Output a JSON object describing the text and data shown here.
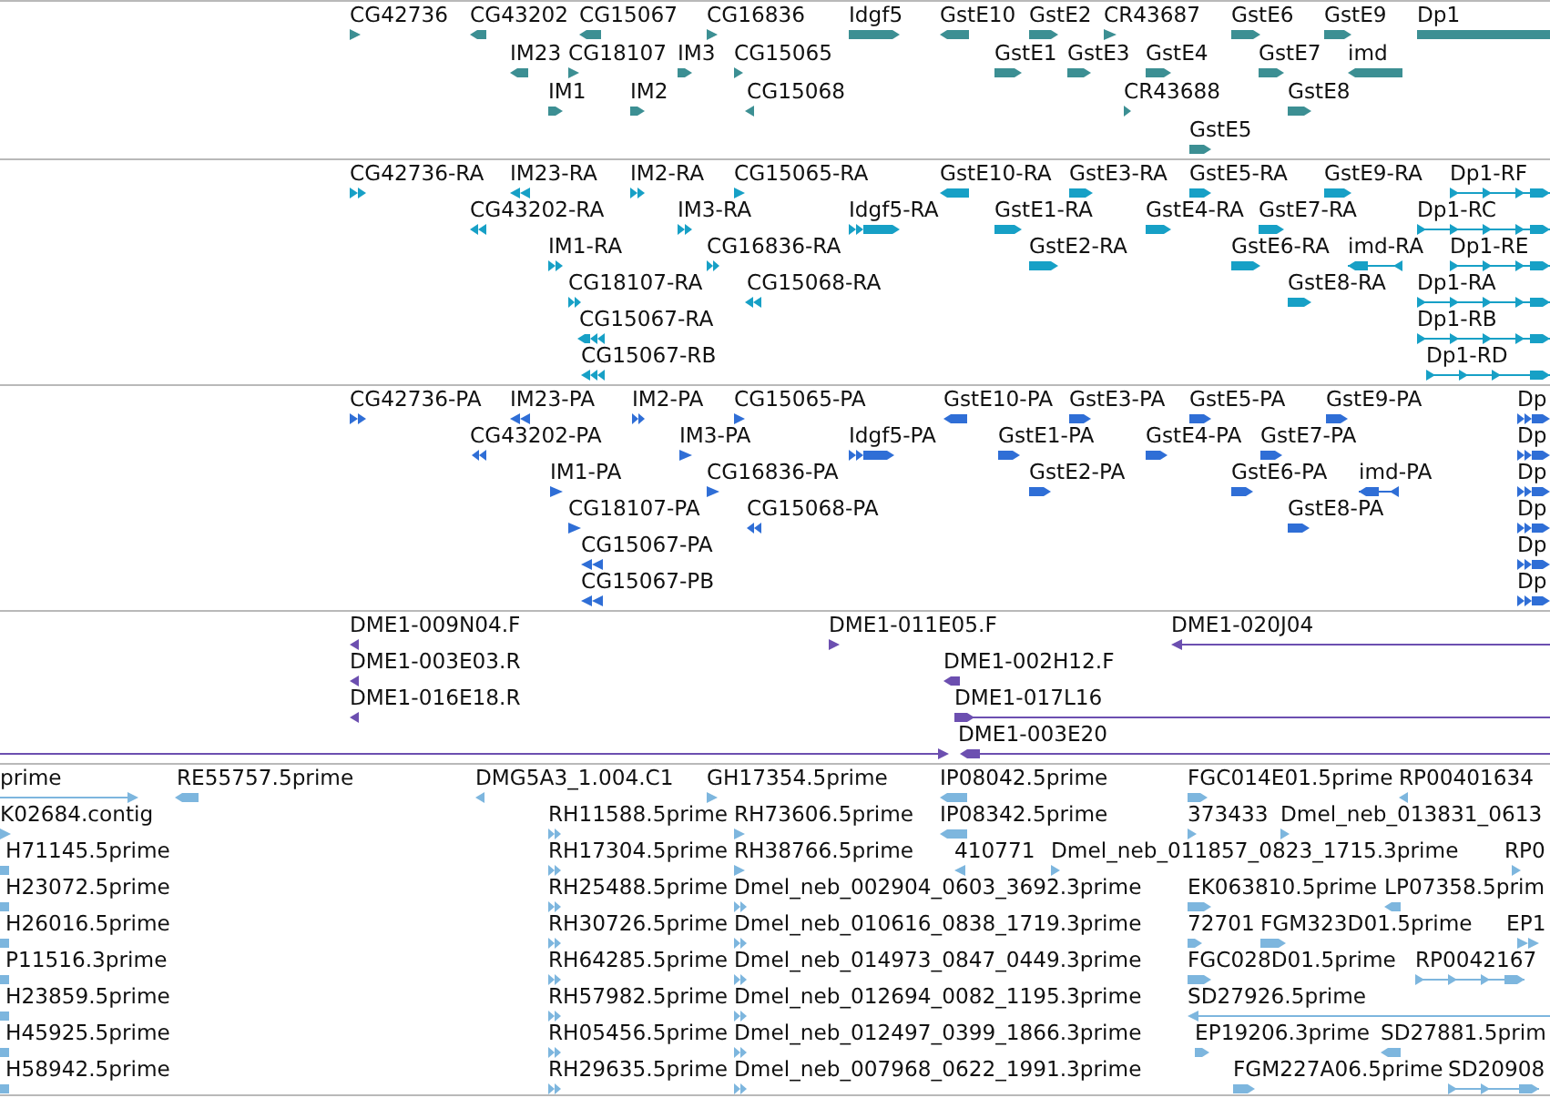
{
  "tracks": [
    {
      "color": "#3c8f93",
      "rows": [
        {
          "features": [
            {
              "label": "CG42736",
              "reverse": false
            },
            {
              "label": "CG43202",
              "reverse": true
            },
            {
              "label": "CG15067",
              "reverse": true
            },
            {
              "label": "CG16836",
              "reverse": false
            },
            {
              "label": "Idgf5",
              "reverse": false
            },
            {
              "label": "GstE10",
              "reverse": true
            },
            {
              "label": "GstE2",
              "reverse": false
            },
            {
              "label": "CR43687",
              "reverse": false
            },
            {
              "label": "GstE6",
              "reverse": false
            },
            {
              "label": "GstE9",
              "reverse": false
            },
            {
              "label": "Dp1"
            }
          ]
        },
        {
          "features": [
            {
              "label": "IM23",
              "reverse": true
            },
            {
              "label": "CG18107",
              "reverse": false
            },
            {
              "label": "IM3",
              "reverse": false
            },
            {
              "label": "CG15065",
              "reverse": false
            },
            {
              "label": "GstE1",
              "reverse": false
            },
            {
              "label": "GstE3",
              "reverse": false
            },
            {
              "label": "GstE4",
              "reverse": false
            },
            {
              "label": "GstE7",
              "reverse": false
            },
            {
              "label": "imd",
              "reverse": true
            }
          ]
        },
        {
          "features": [
            {
              "label": "IM1",
              "reverse": false
            },
            {
              "label": "IM2",
              "reverse": false
            },
            {
              "label": "CG15068",
              "reverse": true
            },
            {
              "label": "CR43688",
              "reverse": false
            },
            {
              "label": "GstE8",
              "reverse": false
            }
          ]
        },
        {
          "features": [
            {
              "label": "GstE5",
              "reverse": false
            }
          ]
        }
      ]
    },
    {
      "color": "#17a0c6",
      "rows": [
        {
          "features": [
            {
              "label": "CG42736-RA",
              "reverse": false
            },
            {
              "label": "IM23-RA",
              "reverse": true
            },
            {
              "label": "IM2-RA",
              "reverse": false
            },
            {
              "label": "CG15065-RA",
              "reverse": false
            },
            {
              "label": "GstE10-RA",
              "reverse": true
            },
            {
              "label": "GstE3-RA",
              "reverse": false
            },
            {
              "label": "GstE5-RA",
              "reverse": false
            },
            {
              "label": "GstE9-RA",
              "reverse": false
            },
            {
              "label": "Dp1-RF",
              "reverse": false
            }
          ]
        },
        {
          "features": [
            {
              "label": "CG43202-RA",
              "reverse": true
            },
            {
              "label": "IM3-RA",
              "reverse": false
            },
            {
              "label": "Idgf5-RA",
              "reverse": false
            },
            {
              "label": "GstE1-RA",
              "reverse": false
            },
            {
              "label": "GstE4-RA",
              "reverse": false
            },
            {
              "label": "GstE7-RA",
              "reverse": false
            },
            {
              "label": "Dp1-RC",
              "reverse": false
            }
          ]
        },
        {
          "features": [
            {
              "label": "IM1-RA",
              "reverse": false
            },
            {
              "label": "CG16836-RA",
              "reverse": false
            },
            {
              "label": "GstE2-RA",
              "reverse": false
            },
            {
              "label": "GstE6-RA",
              "reverse": false
            },
            {
              "label": "imd-RA",
              "reverse": true
            },
            {
              "label": "Dp1-RE",
              "reverse": false
            }
          ]
        },
        {
          "features": [
            {
              "label": "CG18107-RA",
              "reverse": false
            },
            {
              "label": "CG15068-RA",
              "reverse": true
            },
            {
              "label": "GstE8-RA",
              "reverse": false
            },
            {
              "label": "Dp1-RA",
              "reverse": false
            }
          ]
        },
        {
          "features": [
            {
              "label": "CG15067-RA",
              "reverse": true
            },
            {
              "label": "Dp1-RB",
              "reverse": false
            }
          ]
        },
        {
          "features": [
            {
              "label": "CG15067-RB",
              "reverse": true
            },
            {
              "label": "Dp1-RD",
              "reverse": false
            }
          ]
        }
      ]
    },
    {
      "color": "#2f6ed6",
      "rows": [
        {
          "features": [
            {
              "label": "CG42736-PA",
              "reverse": false
            },
            {
              "label": "IM23-PA",
              "reverse": true
            },
            {
              "label": "IM2-PA",
              "reverse": false
            },
            {
              "label": "CG15065-PA",
              "reverse": false
            },
            {
              "label": "GstE10-PA",
              "reverse": true
            },
            {
              "label": "GstE3-PA",
              "reverse": false
            },
            {
              "label": "GstE5-PA",
              "reverse": false
            },
            {
              "label": "GstE9-PA",
              "reverse": false
            },
            {
              "label": "Dp",
              "reverse": false
            }
          ]
        },
        {
          "features": [
            {
              "label": "CG43202-PA",
              "reverse": true
            },
            {
              "label": "IM3-PA",
              "reverse": false
            },
            {
              "label": "Idgf5-PA",
              "reverse": false
            },
            {
              "label": "GstE1-PA",
              "reverse": false
            },
            {
              "label": "GstE4-PA",
              "reverse": false
            },
            {
              "label": "GstE7-PA",
              "reverse": false
            },
            {
              "label": "Dp",
              "reverse": false
            }
          ]
        },
        {
          "features": [
            {
              "label": "IM1-PA",
              "reverse": false
            },
            {
              "label": "CG16836-PA",
              "reverse": false
            },
            {
              "label": "GstE2-PA",
              "reverse": false
            },
            {
              "label": "GstE6-PA",
              "reverse": false
            },
            {
              "label": "imd-PA",
              "reverse": true
            },
            {
              "label": "Dp",
              "reverse": false
            }
          ]
        },
        {
          "features": [
            {
              "label": "CG18107-PA",
              "reverse": false
            },
            {
              "label": "CG15068-PA",
              "reverse": true
            },
            {
              "label": "GstE8-PA",
              "reverse": false
            },
            {
              "label": "Dp",
              "reverse": false
            }
          ]
        },
        {
          "features": [
            {
              "label": "CG15067-PA",
              "reverse": true
            },
            {
              "label": "Dp",
              "reverse": false
            }
          ]
        },
        {
          "features": [
            {
              "label": "CG15067-PB",
              "reverse": true
            },
            {
              "label": "Dp",
              "reverse": false
            }
          ]
        }
      ]
    },
    {
      "color": "#6c4fb0",
      "rows": [
        {
          "features": [
            {
              "label": "DME1-009N04.F",
              "reverse": true
            },
            {
              "label": "DME1-011E05.F",
              "reverse": false
            },
            {
              "label": "DME1-020J04",
              "reverse": true
            }
          ]
        },
        {
          "features": [
            {
              "label": "DME1-003E03.R",
              "reverse": true
            },
            {
              "label": "DME1-002H12.F",
              "reverse": true
            }
          ]
        },
        {
          "features": [
            {
              "label": "DME1-016E18.R",
              "reverse": true
            },
            {
              "label": "DME1-017L16",
              "reverse": false
            }
          ]
        },
        {
          "features": [
            {
              "reverse": false
            },
            {
              "label": "DME1-003E20",
              "reverse": true
            }
          ]
        }
      ]
    },
    {
      "color": "#7db6de",
      "rows": [
        {
          "features": [
            {
              "label": "prime",
              "reverse": false
            },
            {
              "label": "RE55757.5prime",
              "reverse": true
            },
            {
              "label": "DMG5A3_1.004.C1",
              "reverse": true
            },
            {
              "label": "GH17354.5prime",
              "reverse": false
            },
            {
              "label": "IP08042.5prime",
              "reverse": true
            },
            {
              "label": "FGC014E01.5prime",
              "reverse": false
            },
            {
              "label": "RP00401634",
              "reverse": true
            }
          ]
        },
        {
          "features": [
            {
              "label": "K02684.contig",
              "reverse": false
            },
            {
              "label": "RH11588.5prime",
              "reverse": false
            },
            {
              "label": "RH73606.5prime",
              "reverse": false
            },
            {
              "label": "IP08342.5prime",
              "reverse": true
            },
            {
              "label": "373433",
              "reverse": false
            },
            {
              "label": "Dmel_neb_013831_0613",
              "reverse": false
            }
          ]
        },
        {
          "features": [
            {
              "label": "H71145.5prime"
            },
            {
              "label": "RH17304.5prime",
              "reverse": false
            },
            {
              "label": "RH38766.5prime",
              "reverse": false
            },
            {
              "label": "410771",
              "reverse": true
            },
            {
              "label": "Dmel_neb_011857_0823_1715.3prime",
              "reverse": false
            },
            {
              "label": "RP0",
              "reverse": false
            }
          ]
        },
        {
          "features": [
            {
              "label": "H23072.5prime"
            },
            {
              "label": "RH25488.5prime",
              "reverse": false
            },
            {
              "label": "Dmel_neb_002904_0603_3692.3prime",
              "reverse": false
            },
            {
              "label": "EK063810.5prime",
              "reverse": false
            },
            {
              "label": "LP07358.5prim",
              "reverse": true
            }
          ]
        },
        {
          "features": [
            {
              "label": "H26016.5prime"
            },
            {
              "label": "RH30726.5prime",
              "reverse": false
            },
            {
              "label": "Dmel_neb_010616_0838_1719.3prime",
              "reverse": false
            },
            {
              "label": "72701",
              "reverse": false
            },
            {
              "label": "FGM323D01.5prime",
              "reverse": false
            },
            {
              "label": "EP1",
              "reverse": false
            }
          ]
        },
        {
          "features": [
            {
              "label": "P11516.3prime"
            },
            {
              "label": "RH64285.5prime",
              "reverse": false
            },
            {
              "label": "Dmel_neb_014973_0847_0449.3prime",
              "reverse": false
            },
            {
              "label": "FGC028D01.5prime",
              "reverse": false
            },
            {
              "label": "RP0042167",
              "reverse": false
            }
          ]
        },
        {
          "features": [
            {
              "label": "H23859.5prime"
            },
            {
              "label": "RH57982.5prime",
              "reverse": false
            },
            {
              "label": "Dmel_neb_012694_0082_1195.3prime",
              "reverse": false
            },
            {
              "label": "SD27926.5prime",
              "reverse": true
            }
          ]
        },
        {
          "features": [
            {
              "label": "H45925.5prime"
            },
            {
              "label": "RH05456.5prime",
              "reverse": false
            },
            {
              "label": "Dmel_neb_012497_0399_1866.3prime",
              "reverse": false
            },
            {
              "label": "EP19206.3prime",
              "reverse": false
            },
            {
              "label": "SD27881.5prim",
              "reverse": true
            }
          ]
        },
        {
          "features": [
            {
              "label": "H58942.5prime"
            },
            {
              "label": "RH29635.5prime",
              "reverse": false
            },
            {
              "label": "Dmel_neb_007968_0622_1991.3prime",
              "reverse": false
            },
            {
              "label": "FGM227A06.5prime",
              "reverse": false
            },
            {
              "label": "SD20908",
              "reverse": false
            }
          ]
        }
      ]
    }
  ]
}
